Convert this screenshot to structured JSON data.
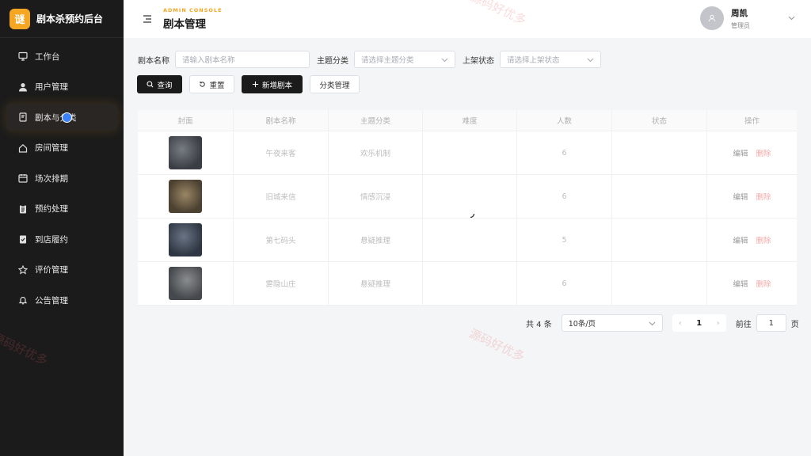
{
  "brand": {
    "logo": "谜",
    "title": "剧本杀预约后台"
  },
  "nav": [
    {
      "label": "工作台",
      "icon": "monitor-icon"
    },
    {
      "label": "用户管理",
      "icon": "user-icon"
    },
    {
      "label": "剧本与分类",
      "icon": "book-icon",
      "active": true
    },
    {
      "label": "房间管理",
      "icon": "home-icon"
    },
    {
      "label": "场次排期",
      "icon": "calendar-icon"
    },
    {
      "label": "预约处理",
      "icon": "clipboard-icon"
    },
    {
      "label": "到店履约",
      "icon": "clipboard-check-icon"
    },
    {
      "label": "评价管理",
      "icon": "star-icon"
    },
    {
      "label": "公告管理",
      "icon": "bell-icon"
    }
  ],
  "header": {
    "kicker": "ADMIN CONSOLE",
    "title": "剧本管理",
    "user_name": "周凯",
    "user_role": "管理员"
  },
  "filters": {
    "name_label": "剧本名称",
    "name_placeholder": "请输入剧本名称",
    "theme_label": "主题分类",
    "theme_placeholder": "请选择主题分类",
    "status_label": "上架状态",
    "status_placeholder": "请选择上架状态"
  },
  "actions": {
    "search": "查询",
    "reset": "重置",
    "add": "新增剧本",
    "category": "分类管理"
  },
  "table": {
    "columns": [
      "封面",
      "剧本名称",
      "主题分类",
      "难度",
      "人数",
      "状态",
      "操作"
    ],
    "edit_label": "编辑",
    "delete_label": "删除",
    "rows": [
      {
        "name": "午夜来客",
        "theme": "欢乐机制",
        "difficulty": "",
        "players": "6",
        "status": "",
        "cover_color": "#4a4f55"
      },
      {
        "name": "旧城来信",
        "theme": "情感沉浸",
        "difficulty": "",
        "players": "6",
        "status": "",
        "cover_color": "#5e5240"
      },
      {
        "name": "第七码头",
        "theme": "悬疑推理",
        "difficulty": "",
        "players": "5",
        "status": "",
        "cover_color": "#3c4452"
      },
      {
        "name": "雾隐山庄",
        "theme": "悬疑推理",
        "difficulty": "",
        "players": "6",
        "status": "",
        "cover_color": "#55585c"
      }
    ]
  },
  "pagination": {
    "total": "共 4 条",
    "page_size": "10条/页",
    "current": "1",
    "goto_label": "前往",
    "goto_value": "1",
    "unit": "页"
  },
  "watermark": {
    "text": "源码好优多"
  }
}
